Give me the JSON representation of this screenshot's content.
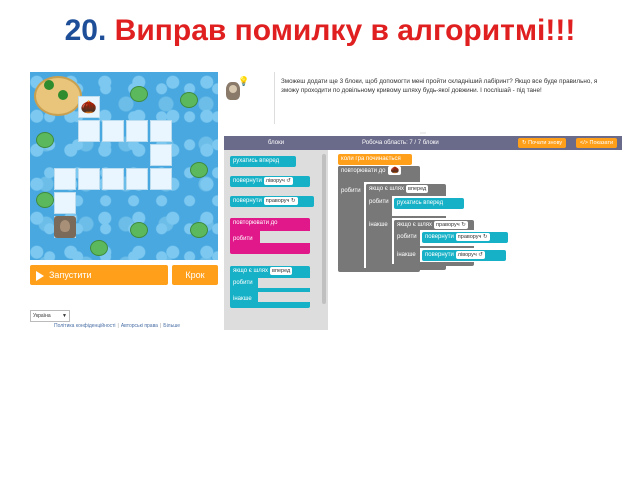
{
  "slide": {
    "number": "20.",
    "title": "Виправ помилку в алгоритмі!!!"
  },
  "game": {
    "run_label": "Запустити",
    "step_label": "Крок",
    "language": "Україна",
    "footer": [
      "Політика конфіденційності",
      "Авторські права",
      "Більше"
    ]
  },
  "speech": {
    "text": "Зможеш додати ще 3 блоки, щоб допомогти мені пройти складніший лабіринт? Якщо все буде правильно, я зможу проходити по довільному кривому шляху будь-якої довжини. І послішай - під тане!"
  },
  "header": {
    "blocks_label": "блоки",
    "workspace_label": "Робоча область: 7 / 7 блоки",
    "reset_label": "Почати знову",
    "show_label": "Показати"
  },
  "toolbox": {
    "move_forward": "рухатись вперед",
    "turn": "повернути",
    "left": "ліворуч ↺",
    "right": "праворуч ↻",
    "repeat_until": "повторювати до",
    "do": "робити",
    "if_path": "якщо є шлях",
    "forward": "вперед",
    "else": "інакше"
  },
  "workspace": {
    "when_run": "коли гра починається",
    "repeat_until": "повторювати до",
    "do": "робити",
    "if_path": "якщо є шлях",
    "forward": "вперед",
    "move_forward": "рухатись вперед",
    "else": "інакше",
    "right": "праворуч ↻",
    "turn": "повернути",
    "left": "ліворуч ↺"
  },
  "icons": {
    "acorn": "🌰",
    "bulb": "💡"
  },
  "colors": {
    "title_number": "#1f4e99",
    "title_text": "#e02020",
    "motion": "#16b1c7",
    "loop": "#e0188a",
    "logic": "#787878",
    "event": "#ff9f1a"
  }
}
